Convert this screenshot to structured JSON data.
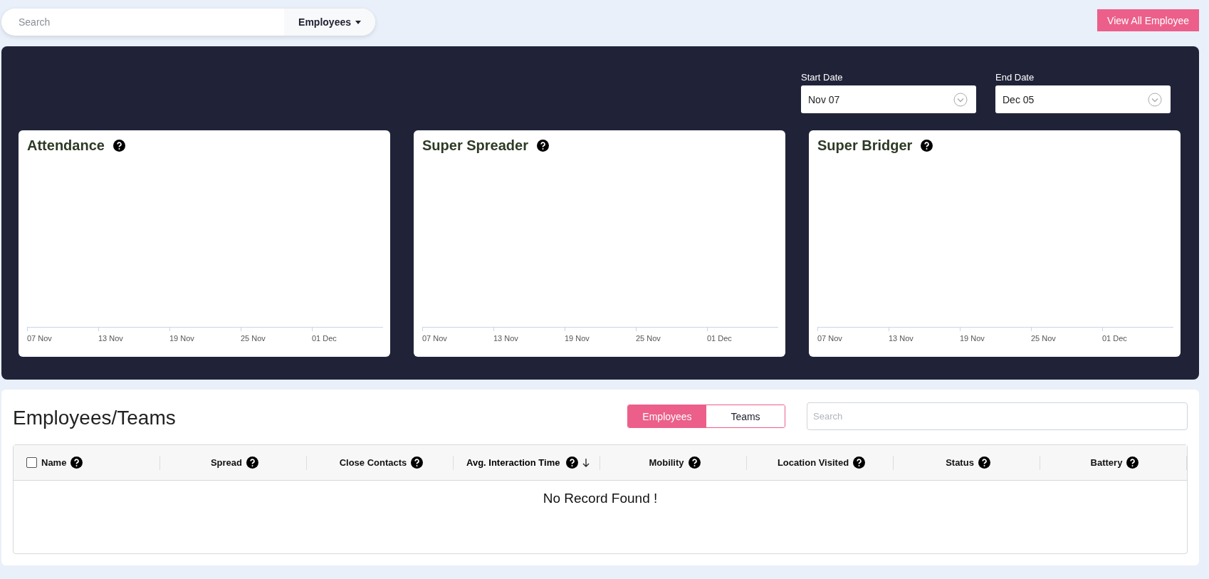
{
  "top_bar": {
    "search": {
      "placeholder": "Search"
    },
    "dropdown": {
      "label": "Employees"
    },
    "button": "View All Employee"
  },
  "dates": [
    {
      "label": "Start Date",
      "value": "Nov 07"
    },
    {
      "label": "End Date",
      "value": "Dec 05"
    }
  ],
  "charts": [
    {
      "title": "Attendance",
      "axis_labels": [
        "07 Nov",
        "13 Nov",
        "19 Nov",
        "25 Nov",
        "01 Dec"
      ]
    },
    {
      "title": "Super Spreader",
      "axis_labels": [
        "07 Nov",
        "13 Nov",
        "19 Nov",
        "25 Nov",
        "01 Dec"
      ]
    },
    {
      "title": "Super Bridger",
      "axis_labels": [
        "07 Nov",
        "13 Nov",
        "19 Nov",
        "25 Nov",
        "01 Dec"
      ]
    }
  ],
  "list": {
    "title": "Employees/Teams",
    "toggle": [
      {
        "label": "Employees",
        "selected": true
      },
      {
        "label": "Teams",
        "selected": false
      }
    ],
    "search": {
      "placeholder": "Search"
    },
    "select_all": {
      "checked": false
    },
    "columns": [
      {
        "label": "Name",
        "sorted": false
      },
      {
        "label": "Spread",
        "sorted": false
      },
      {
        "label": "Close Contacts",
        "sorted": false
      },
      {
        "label": "Avg. Interaction Time",
        "sorted": true
      },
      {
        "label": "Mobility",
        "sorted": false
      },
      {
        "label": "Location Visited",
        "sorted": false
      },
      {
        "label": "Status",
        "sorted": false
      },
      {
        "label": "Battery",
        "sorted": false
      }
    ],
    "empty_message": "No Record Found !"
  }
}
